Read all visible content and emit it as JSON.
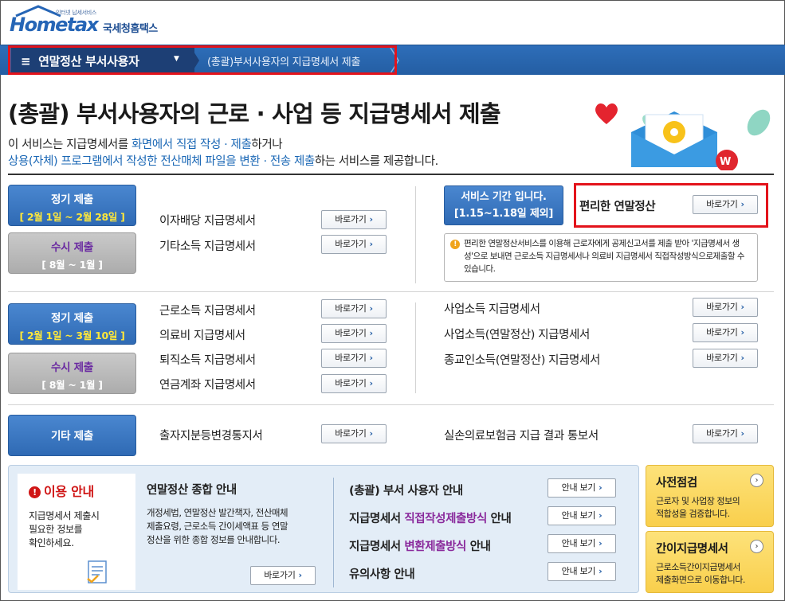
{
  "logo": {
    "sub": "인터넷 납세서비스",
    "main": "Hometax",
    "ko": "국세청홈택스"
  },
  "nav": {
    "menu_label": "연말정산 부서사용자",
    "breadcrumb": "(총괄)부서사용자의 지급명세서 제출"
  },
  "title": "(총괄) 부서사용자의 근로 · 사업 등 지급명세서 제출",
  "desc": {
    "p1_a": "이 서비스는 지급명세서를 ",
    "p1_hl": "화면에서 직접 작성 · 제출",
    "p1_b": "하거나",
    "p2_hl": "상용(자체) 프로그램에서 작성한 전산매체 파일을 변환 · 전송 제출",
    "p2_b": "하는 서비스를 제공합니다."
  },
  "go_label": "바로가기",
  "section1": {
    "regular": {
      "title": "정기 제출",
      "period": "[ 2월 1일 ~ 2월 28일 ]"
    },
    "occasional": {
      "title": "수시 제출",
      "period": "[ 8월 ~ 1월 ]"
    },
    "items": [
      "이자배당 지급명세서",
      "기타소득 지급명세서"
    ],
    "service_period": {
      "l1": "서비스 기간 입니다.",
      "l2": "[1.15~1.18일 제외]"
    },
    "easy_label": "편리한 연말정산",
    "notice": "편리한 연말정산서비스를 이용해 근로자에게 공제신고서를 제출 받아 '지급명세서 생성'으로 보내면 근로소득 지급명세서나 의료비 지급명세서 직접작성방식으로제출할 수 있습니다."
  },
  "section2": {
    "regular": {
      "title": "정기 제출",
      "period": "[ 2월 1일 ~ 3월 10일 ]"
    },
    "occasional": {
      "title": "수시 제출",
      "period": "[ 8월 ~ 1월 ]"
    },
    "left_items": [
      "근로소득 지급명세서",
      "의료비 지급명세서",
      "퇴직소득 지급명세서",
      "연금계좌 지급명세서"
    ],
    "right_items": [
      "사업소득 지급명세서",
      "사업소득(연말정산) 지급명세서",
      "종교인소득(연말정산) 지급명세서"
    ]
  },
  "section3": {
    "title": "기타 제출",
    "left_item": "출자지분등변경통지서",
    "right_item": "실손의료보험금 지급 결과 통보서"
  },
  "info": {
    "usage_title": "이용 안내",
    "usage_text": [
      "지급명세서 제출시",
      "필요한 정보를",
      "확인하세요."
    ],
    "guide_title": "연말정산 종합 안내",
    "guide_text": [
      "개정세법, 연말정산 발간책자, 전산매체",
      "제출요령, 근로소득 간이세액표 등 연말",
      "정산을 위한 종합 정보를 안내합니다."
    ],
    "view_label": "안내 보기",
    "rows": [
      {
        "a": "(총괄) 부서 사용자 안내",
        "hl": "",
        "b": ""
      },
      {
        "a": "지급명세서 ",
        "hl": "직접작성제출방식",
        "b": " 안내"
      },
      {
        "a": "지급명세서 ",
        "hl": "변환제출방식",
        "b": " 안내"
      },
      {
        "a": "유의사항 안내",
        "hl": "",
        "b": ""
      }
    ]
  },
  "side_cards": [
    {
      "title": "사전점검",
      "desc1": "근로자 및 사업장 정보의",
      "desc2": "적합성을 검증합니다."
    },
    {
      "title": "간이지급명세서",
      "desc1": "근로소득간이지급명세서",
      "desc2": "제출화면으로 이동합니다."
    }
  ],
  "colors": {
    "brand_blue": "#2f6ab4",
    "highlight_red": "#e3131b",
    "side_card_yellow": "#f9cf4c"
  }
}
